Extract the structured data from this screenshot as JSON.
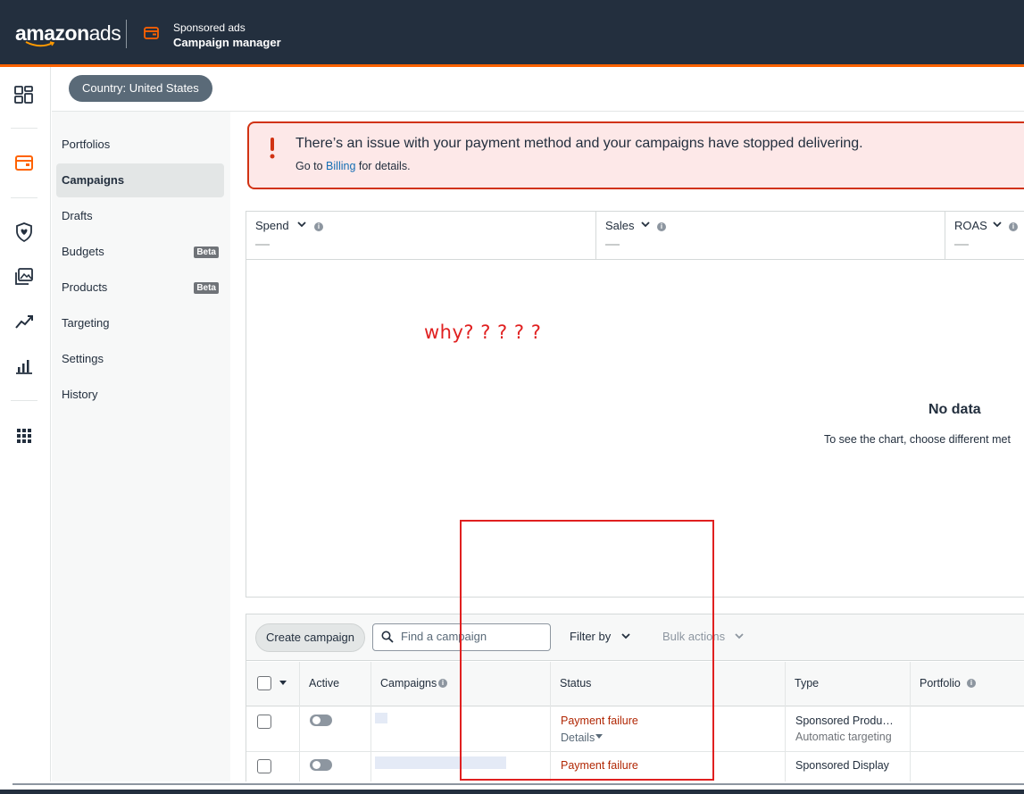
{
  "header": {
    "logo_text_a": "amazon",
    "logo_text_b": "ads",
    "product_sub": "Sponsored ads",
    "product_title": "Campaign manager",
    "accent_color": "#ff6200",
    "bg_color": "#232f3e"
  },
  "rail": {
    "icons": [
      "dashboard-icon",
      "campaign-manager-icon",
      "brand-shield-icon",
      "creative-assets-icon",
      "trend-icon",
      "reports-icon",
      "apps-grid-icon"
    ]
  },
  "country": {
    "label": "Country: United States"
  },
  "subnav": {
    "items": [
      {
        "label": "Portfolios"
      },
      {
        "label": "Campaigns",
        "active": true
      },
      {
        "label": "Drafts"
      },
      {
        "label": "Budgets",
        "badge": "Beta"
      },
      {
        "label": "Products",
        "badge": "Beta"
      },
      {
        "label": "Targeting"
      },
      {
        "label": "Settings"
      },
      {
        "label": "History"
      }
    ]
  },
  "alert": {
    "title": "There’s an issue with your payment method and your campaigns have stopped delivering.",
    "body_prefix": "Go to ",
    "body_link": "Billing",
    "body_suffix": " for details."
  },
  "metrics": [
    {
      "label": "Spend",
      "value": "—"
    },
    {
      "label": "Sales",
      "value": "—"
    },
    {
      "label": "ROAS",
      "value": "—"
    }
  ],
  "annotation": "why? ? ? ? ?",
  "chart": {
    "nodata_title": "No data",
    "nodata_body": "To see the chart, choose different met"
  },
  "toolbar": {
    "create_label": "Create campaign",
    "search_placeholder": "Find a campaign",
    "filter_label": "Filter by",
    "bulk_label": "Bulk actions"
  },
  "table": {
    "headers": {
      "active": "Active",
      "campaigns": "Campaigns",
      "status": "Status",
      "type": "Type",
      "portfolio": "Portfolio"
    },
    "rows": [
      {
        "status": "Payment failure",
        "details": "Details",
        "type": "Sponsored Produ…",
        "type_sub": "Automatic targeting"
      },
      {
        "status": "Payment failure",
        "type": "Sponsored Display"
      }
    ]
  }
}
